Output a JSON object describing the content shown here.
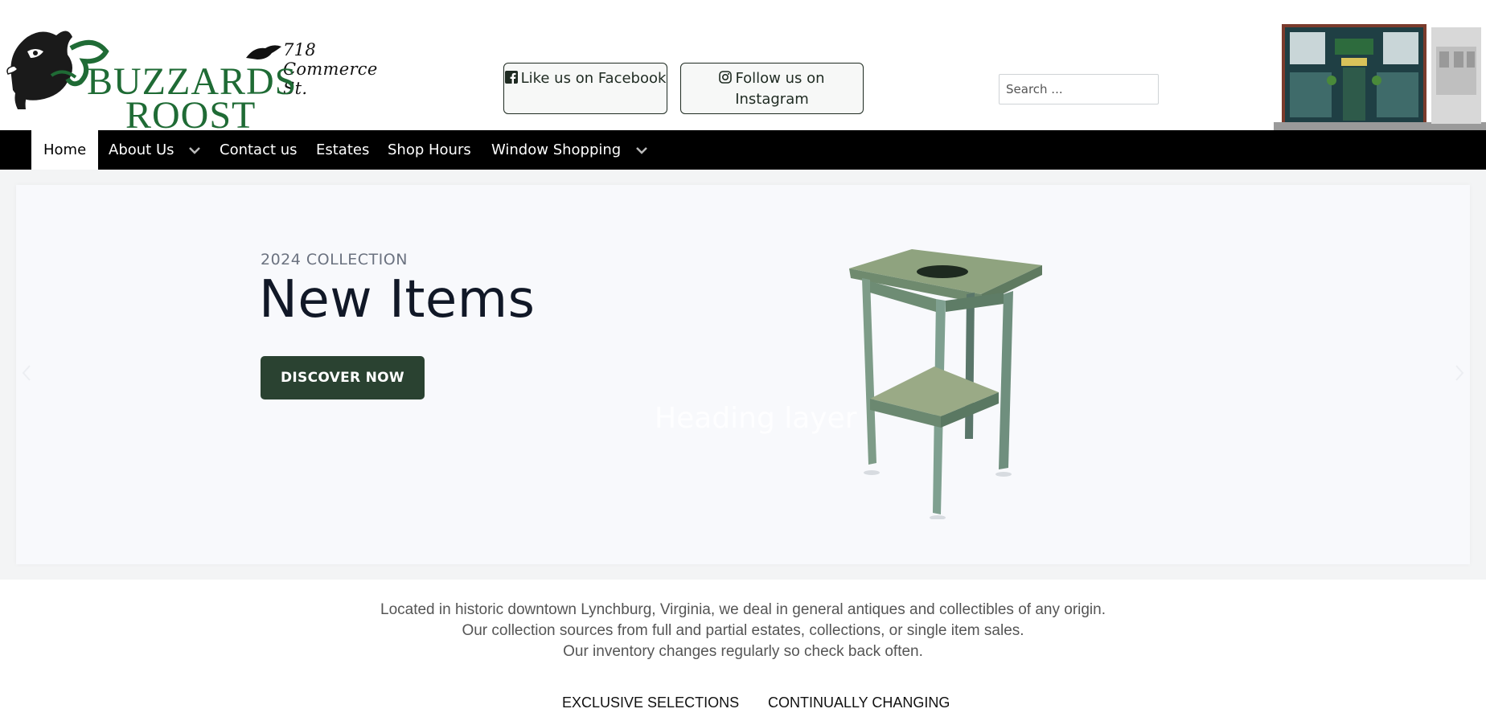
{
  "header": {
    "brand_line1": "BUZZARDS",
    "brand_line2": "ROOST",
    "address": "718 Commerce St.",
    "facebook_label": "Like us on Facebook",
    "instagram_label": "Follow us on Instagram",
    "search_placeholder": "Search ..."
  },
  "nav": {
    "items": [
      {
        "label": "Home",
        "active": true
      },
      {
        "label": "About Us",
        "has_dropdown": true
      },
      {
        "label": "Contact us"
      },
      {
        "label": "Estates"
      },
      {
        "label": "Shop Hours"
      },
      {
        "label": "Window Shopping",
        "has_dropdown": true
      }
    ]
  },
  "hero": {
    "eyebrow": "2024 COLLECTION",
    "title": "New Items",
    "cta": "DISCOVER NOW",
    "ghost_heading": "Heading layer"
  },
  "intro": {
    "lines": [
      "Located in historic downtown Lynchburg, Virginia, we deal in general antiques and collectibles of any origin.",
      "Our collection sources from full and partial estates, collections, or single item sales.",
      "Our inventory changes regularly so check back often."
    ]
  },
  "features": [
    "EXCLUSIVE SELECTIONS",
    "CONTINUALLY CHANGING"
  ],
  "colors": {
    "brand_green": "#1f6b35",
    "nav_bg": "#000000",
    "cta_bg": "#2a4231",
    "hero_bg": "#f8f9fc"
  },
  "icons": [
    "buzzard-logo-icon",
    "facebook-icon",
    "instagram-icon",
    "chevron-down-icon",
    "arrow-left-icon",
    "arrow-right-icon"
  ]
}
